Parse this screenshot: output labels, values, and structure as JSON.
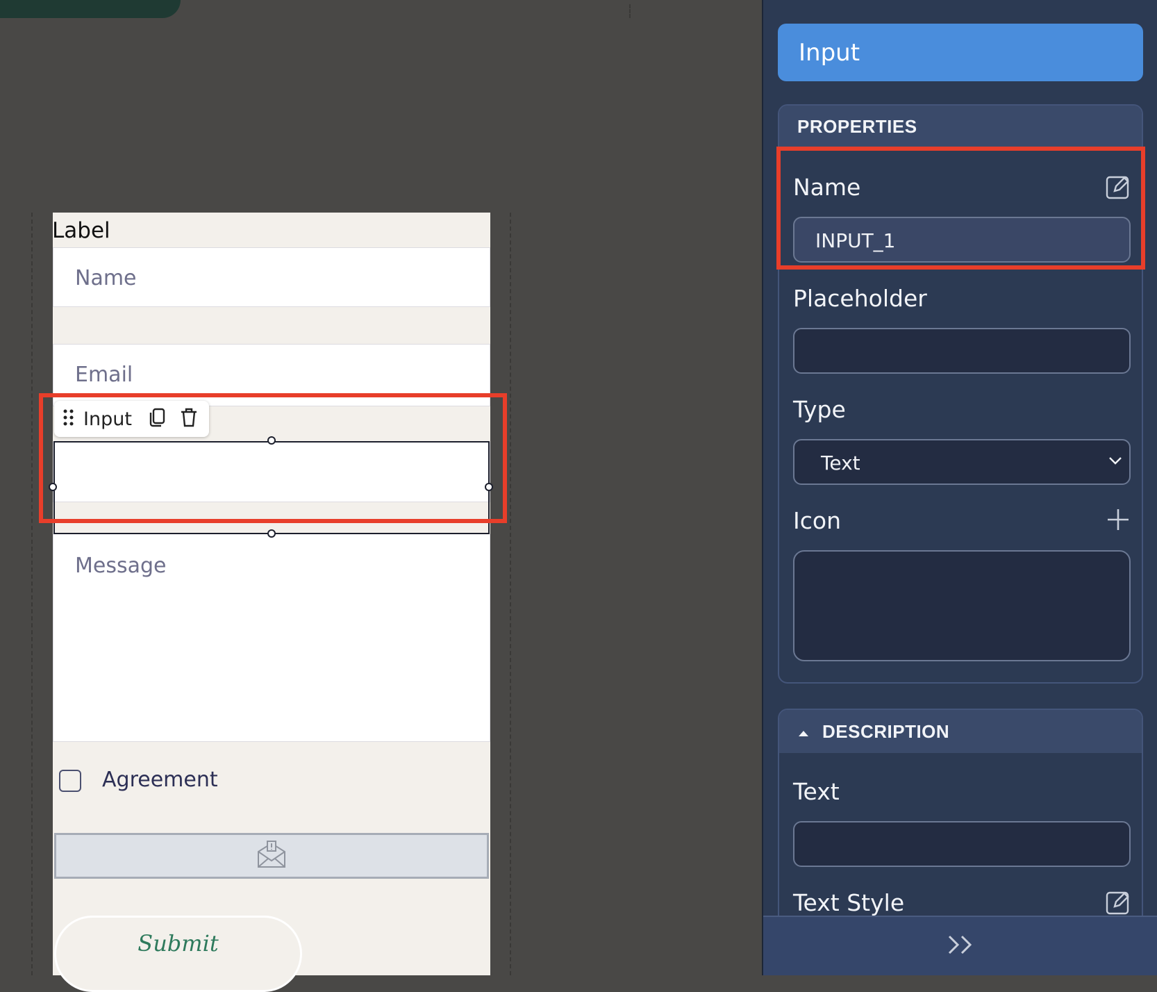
{
  "canvas": {
    "form": {
      "label": "Label",
      "name_placeholder": "Name",
      "email_placeholder": "Email",
      "message_placeholder": "Message",
      "agreement_label": "Agreement",
      "submit_label": "Submit"
    },
    "selection_toolbar": {
      "label": "Input",
      "icons": [
        "drag-handle-icon",
        "duplicate-icon",
        "trash-icon"
      ]
    }
  },
  "panel": {
    "header_title": "Input",
    "properties": {
      "section_title": "PROPERTIES",
      "name_label": "Name",
      "name_value": "INPUT_1",
      "placeholder_label": "Placeholder",
      "placeholder_value": "",
      "type_label": "Type",
      "type_value": "Text",
      "icon_label": "Icon"
    },
    "description": {
      "section_title": "DESCRIPTION",
      "text_label": "Text",
      "text_value": "",
      "text_style_label": "Text Style"
    },
    "footer_icon": "expand-right-icon"
  },
  "colors": {
    "canvas_bg": "#494846",
    "form_bg": "#f3f0eb",
    "panel_bg": "#2c3a53",
    "header_accent": "#4a8ddc",
    "highlight_red": "#e83e2a",
    "submit_text": "#2e7a5c"
  }
}
